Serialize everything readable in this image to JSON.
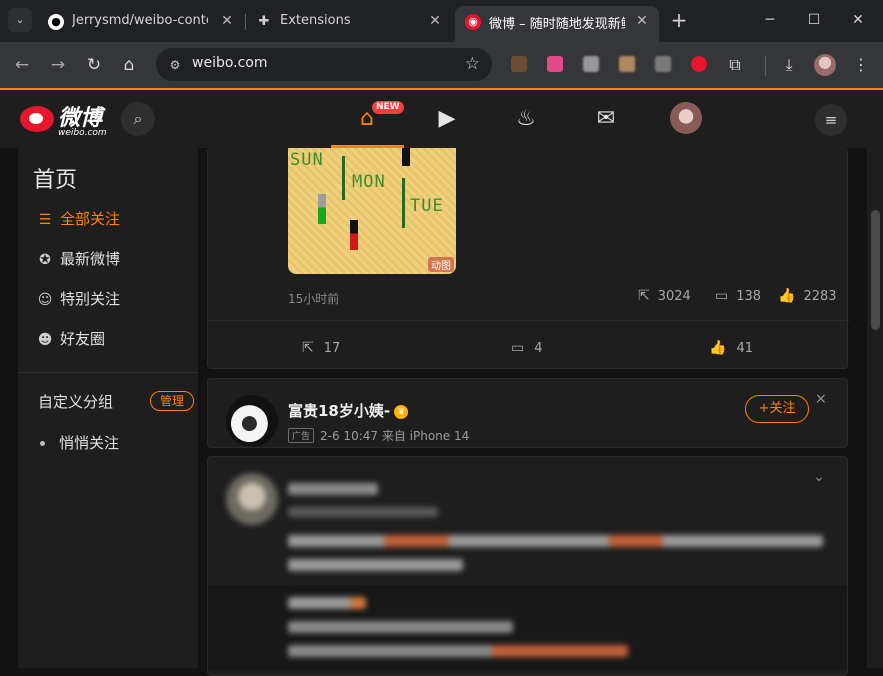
{
  "browser": {
    "tabs": [
      {
        "title": "Jerrysmd/weibo-content-f",
        "icon": "github-icon"
      },
      {
        "title": "Extensions",
        "icon": "puzzle-icon"
      },
      {
        "title": "微博 – 随时随地发现新鲜",
        "icon": "weibo-icon"
      }
    ],
    "url": "weibo.com"
  },
  "header": {
    "logo_text": "微博",
    "logo_sub": "weibo.com",
    "new_badge": "NEW"
  },
  "sidebar": {
    "title": "首页",
    "items": [
      {
        "label": "全部关注",
        "icon": "list-icon"
      },
      {
        "label": "最新微博",
        "icon": "star-circle-icon"
      },
      {
        "label": "特别关注",
        "icon": "user-star-icon"
      },
      {
        "label": "好友圈",
        "icon": "user-plus-icon"
      }
    ],
    "group_title": "自定义分组",
    "manage_label": "管理",
    "sub_items": [
      "悄悄关注"
    ]
  },
  "post1": {
    "gif_words": [
      "SUN",
      "MON",
      "TUE"
    ],
    "gif_tag": "动图",
    "time": "15小时前",
    "reposts": "3024",
    "comments": "138",
    "likes": "2283",
    "footer_reposts": "17",
    "footer_comments": "4",
    "footer_likes": "41"
  },
  "ad_post": {
    "name": "富贵18岁小姨-",
    "ad_badge": "广告",
    "meta": "2-6 10:47 来自 iPhone 14",
    "follow_label": "+关注",
    "close_label": "×"
  }
}
